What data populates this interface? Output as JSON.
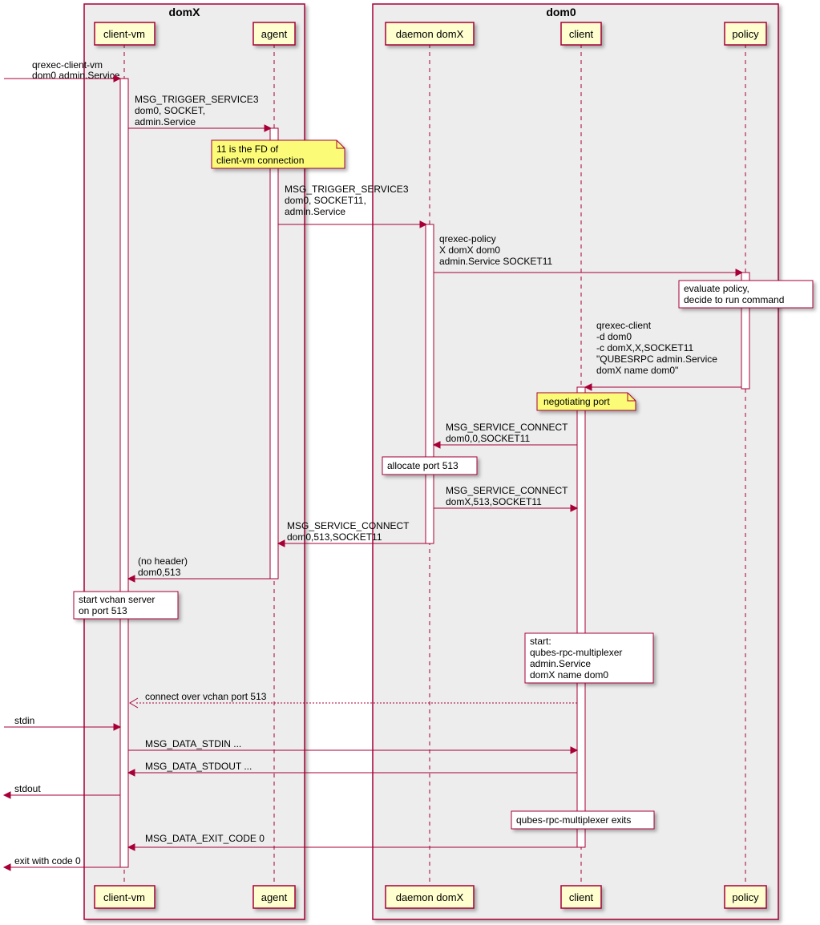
{
  "boxes": {
    "domX": {
      "title": "domX"
    },
    "dom0": {
      "title": "dom0"
    }
  },
  "participants": {
    "clientvm": "client-vm",
    "agent": "agent",
    "daemon": "daemon domX",
    "client": "client",
    "policy": "policy"
  },
  "messages": {
    "entry": {
      "l1": "qrexec-client-vm",
      "l2": "dom0 admin.Service"
    },
    "m1": {
      "l1": "MSG_TRIGGER_SERVICE3",
      "l2": "dom0, SOCKET,",
      "l3": "admin.Service"
    },
    "note1": {
      "l1": "11 is the FD of",
      "l2": "client-vm connection"
    },
    "m2": {
      "l1": "MSG_TRIGGER_SERVICE3",
      "l2": "dom0, SOCKET11,",
      "l3": "admin.Service"
    },
    "m3": {
      "l1": "qrexec-policy",
      "l2": "X domX dom0",
      "l3": "admin.Service SOCKET11"
    },
    "note_policy": {
      "l1": "evaluate policy,",
      "l2": "decide to run command"
    },
    "m4": {
      "l1": "qrexec-client",
      "l2": "-d dom0",
      "l3": "-c domX,X,SOCKET11",
      "l4": "\"QUBESRPC admin.Service",
      "l5": "domX name dom0\""
    },
    "note_neg": "negotiating port",
    "m5": {
      "l1": "MSG_SERVICE_CONNECT",
      "l2": "dom0,0,SOCKET11"
    },
    "note_alloc": "allocate port 513",
    "m6": {
      "l1": "MSG_SERVICE_CONNECT",
      "l2": "domX,513,SOCKET11"
    },
    "m7": {
      "l1": "MSG_SERVICE_CONNECT",
      "l2": "dom0,513,SOCKET11"
    },
    "m8": {
      "l1": "(no header)",
      "l2": "dom0,513"
    },
    "note_vchan": {
      "l1": "start vchan server",
      "l2": "on port 513"
    },
    "note_mux": {
      "l1": "start:",
      "l2": "qubes-rpc-multiplexer",
      "l3": "admin.Service",
      "l4": "domX name dom0"
    },
    "m9": "connect over vchan port 513",
    "stdin": "stdin",
    "m10": "MSG_DATA_STDIN ...",
    "m11": "MSG_DATA_STDOUT ...",
    "stdout": "stdout",
    "note_exit": "qubes-rpc-multiplexer exits",
    "m12": "MSG_DATA_EXIT_CODE 0",
    "exitcode": "exit with code 0"
  },
  "chart_data": {
    "type": "sequence-diagram",
    "boxes": [
      {
        "name": "domX",
        "participants": [
          "client-vm",
          "agent"
        ]
      },
      {
        "name": "dom0",
        "participants": [
          "daemon domX",
          "client",
          "policy"
        ]
      }
    ],
    "participants": [
      "client-vm",
      "agent",
      "daemon domX",
      "client",
      "policy"
    ],
    "external_actor": "(external)",
    "interactions": [
      {
        "from": "(external)",
        "to": "client-vm",
        "label": "qrexec-client-vm dom0 admin.Service",
        "activates": "client-vm"
      },
      {
        "from": "client-vm",
        "to": "agent",
        "label": "MSG_TRIGGER_SERVICE3 dom0, SOCKET, admin.Service",
        "activates": "agent"
      },
      {
        "note_over": "agent",
        "text": "11 is the FD of client-vm connection",
        "style": "yellow"
      },
      {
        "from": "agent",
        "to": "daemon domX",
        "label": "MSG_TRIGGER_SERVICE3 dom0, SOCKET11, admin.Service",
        "activates": "daemon domX"
      },
      {
        "from": "daemon domX",
        "to": "policy",
        "label": "qrexec-policy X domX dom0 admin.Service SOCKET11",
        "activates": "policy"
      },
      {
        "note_over": "policy",
        "text": "evaluate policy, decide to run command",
        "style": "white"
      },
      {
        "from": "policy",
        "to": "client",
        "label": "qrexec-client -d dom0 -c domX,X,SOCKET11 \"QUBESRPC admin.Service domX name dom0\"",
        "activates": "client"
      },
      {
        "note_over": "client",
        "text": "negotiating port",
        "style": "yellow"
      },
      {
        "from": "client",
        "to": "daemon domX",
        "label": "MSG_SERVICE_CONNECT dom0,0,SOCKET11"
      },
      {
        "note_over": "daemon domX",
        "text": "allocate port 513",
        "style": "white"
      },
      {
        "from": "daemon domX",
        "to": "client",
        "label": "MSG_SERVICE_CONNECT domX,513,SOCKET11"
      },
      {
        "from": "daemon domX",
        "to": "agent",
        "label": "MSG_SERVICE_CONNECT dom0,513,SOCKET11",
        "deactivates": "daemon domX"
      },
      {
        "from": "agent",
        "to": "client-vm",
        "label": "(no header) dom0,513",
        "deactivates": "agent"
      },
      {
        "note_over": "client-vm",
        "text": "start vchan server on port 513",
        "style": "white"
      },
      {
        "note_over": "client",
        "text": "start: qubes-rpc-multiplexer admin.Service domX name dom0",
        "style": "white"
      },
      {
        "from": "client",
        "to": "client-vm",
        "label": "connect over vchan port 513",
        "style": "dashed"
      },
      {
        "from": "(external)",
        "to": "client-vm",
        "label": "stdin"
      },
      {
        "from": "client-vm",
        "to": "client",
        "label": "MSG_DATA_STDIN ..."
      },
      {
        "from": "client",
        "to": "client-vm",
        "label": "MSG_DATA_STDOUT ..."
      },
      {
        "from": "client-vm",
        "to": "(external)",
        "label": "stdout"
      },
      {
        "note_over": "client",
        "text": "qubes-rpc-multiplexer exits",
        "style": "white"
      },
      {
        "from": "client",
        "to": "client-vm",
        "label": "MSG_DATA_EXIT_CODE 0",
        "deactivates": "client"
      },
      {
        "from": "client-vm",
        "to": "(external)",
        "label": "exit with code 0",
        "deactivates": "client-vm"
      }
    ]
  }
}
